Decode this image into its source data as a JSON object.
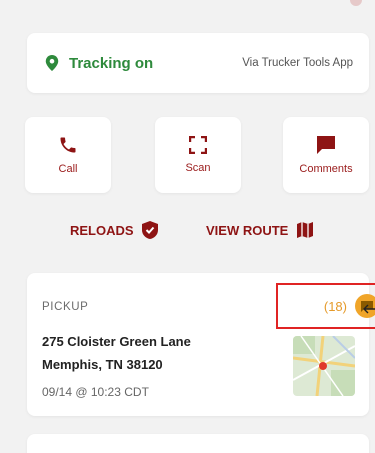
{
  "tracking": {
    "status": "Tracking on",
    "via": "Via Trucker Tools App",
    "status_color": "#2e8a3c"
  },
  "actions": [
    {
      "label": "Call",
      "icon": "phone-icon"
    },
    {
      "label": "Scan",
      "icon": "scan-icon"
    },
    {
      "label": "Comments",
      "icon": "comment-icon"
    }
  ],
  "links": {
    "reloads": "RELOADS",
    "view_route": "VIEW ROUTE"
  },
  "stop": {
    "type": "PICKUP",
    "address_line1": "275 Cloister Green Lane",
    "address_line2": "Memphis, TN 38120",
    "datetime": "09/14 @ 10:23 CDT",
    "message_count": "(18)"
  },
  "colors": {
    "accent": "#8e1414",
    "badge": "#f0a529",
    "highlight_border": "#e02424",
    "background": "#f2f2f2"
  }
}
